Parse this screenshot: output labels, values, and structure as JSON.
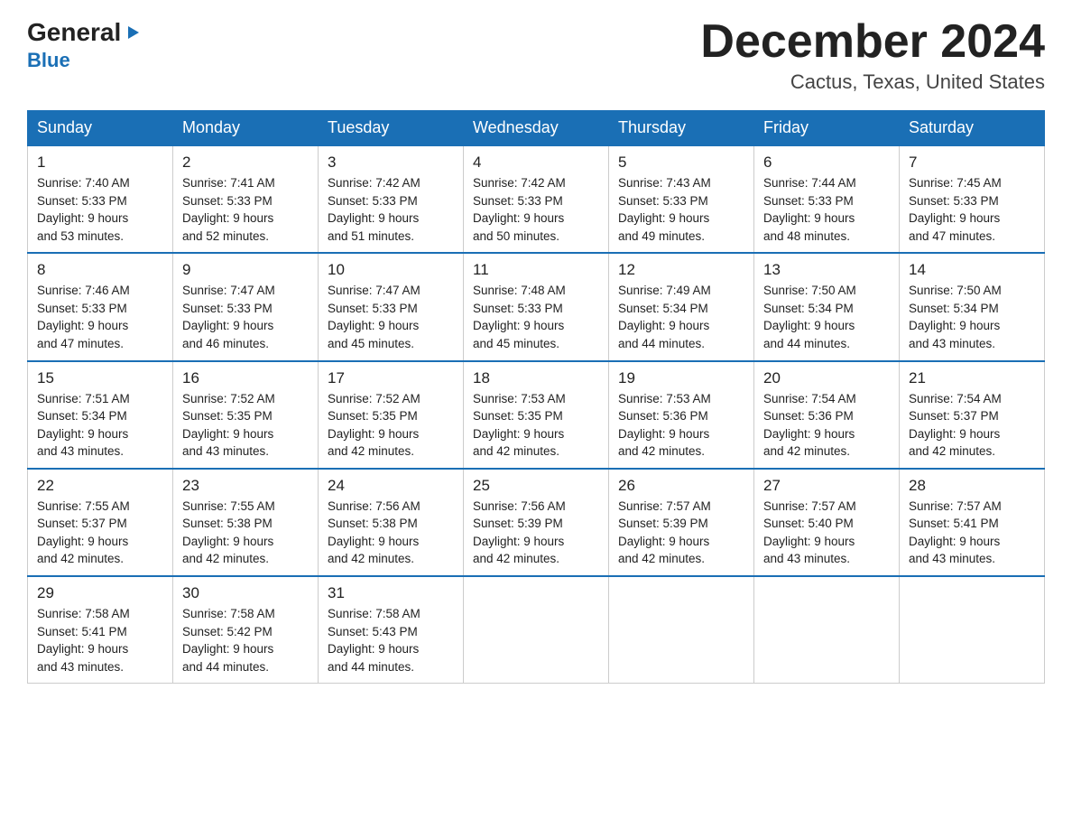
{
  "header": {
    "logo": {
      "general": "General",
      "blue": "Blue"
    },
    "title": "December 2024",
    "location": "Cactus, Texas, United States"
  },
  "weekdays": [
    "Sunday",
    "Monday",
    "Tuesday",
    "Wednesday",
    "Thursday",
    "Friday",
    "Saturday"
  ],
  "weeks": [
    [
      {
        "day": "1",
        "sunrise": "7:40 AM",
        "sunset": "5:33 PM",
        "daylight": "9 hours and 53 minutes."
      },
      {
        "day": "2",
        "sunrise": "7:41 AM",
        "sunset": "5:33 PM",
        "daylight": "9 hours and 52 minutes."
      },
      {
        "day": "3",
        "sunrise": "7:42 AM",
        "sunset": "5:33 PM",
        "daylight": "9 hours and 51 minutes."
      },
      {
        "day": "4",
        "sunrise": "7:42 AM",
        "sunset": "5:33 PM",
        "daylight": "9 hours and 50 minutes."
      },
      {
        "day": "5",
        "sunrise": "7:43 AM",
        "sunset": "5:33 PM",
        "daylight": "9 hours and 49 minutes."
      },
      {
        "day": "6",
        "sunrise": "7:44 AM",
        "sunset": "5:33 PM",
        "daylight": "9 hours and 48 minutes."
      },
      {
        "day": "7",
        "sunrise": "7:45 AM",
        "sunset": "5:33 PM",
        "daylight": "9 hours and 47 minutes."
      }
    ],
    [
      {
        "day": "8",
        "sunrise": "7:46 AM",
        "sunset": "5:33 PM",
        "daylight": "9 hours and 47 minutes."
      },
      {
        "day": "9",
        "sunrise": "7:47 AM",
        "sunset": "5:33 PM",
        "daylight": "9 hours and 46 minutes."
      },
      {
        "day": "10",
        "sunrise": "7:47 AM",
        "sunset": "5:33 PM",
        "daylight": "9 hours and 45 minutes."
      },
      {
        "day": "11",
        "sunrise": "7:48 AM",
        "sunset": "5:33 PM",
        "daylight": "9 hours and 45 minutes."
      },
      {
        "day": "12",
        "sunrise": "7:49 AM",
        "sunset": "5:34 PM",
        "daylight": "9 hours and 44 minutes."
      },
      {
        "day": "13",
        "sunrise": "7:50 AM",
        "sunset": "5:34 PM",
        "daylight": "9 hours and 44 minutes."
      },
      {
        "day": "14",
        "sunrise": "7:50 AM",
        "sunset": "5:34 PM",
        "daylight": "9 hours and 43 minutes."
      }
    ],
    [
      {
        "day": "15",
        "sunrise": "7:51 AM",
        "sunset": "5:34 PM",
        "daylight": "9 hours and 43 minutes."
      },
      {
        "day": "16",
        "sunrise": "7:52 AM",
        "sunset": "5:35 PM",
        "daylight": "9 hours and 43 minutes."
      },
      {
        "day": "17",
        "sunrise": "7:52 AM",
        "sunset": "5:35 PM",
        "daylight": "9 hours and 42 minutes."
      },
      {
        "day": "18",
        "sunrise": "7:53 AM",
        "sunset": "5:35 PM",
        "daylight": "9 hours and 42 minutes."
      },
      {
        "day": "19",
        "sunrise": "7:53 AM",
        "sunset": "5:36 PM",
        "daylight": "9 hours and 42 minutes."
      },
      {
        "day": "20",
        "sunrise": "7:54 AM",
        "sunset": "5:36 PM",
        "daylight": "9 hours and 42 minutes."
      },
      {
        "day": "21",
        "sunrise": "7:54 AM",
        "sunset": "5:37 PM",
        "daylight": "9 hours and 42 minutes."
      }
    ],
    [
      {
        "day": "22",
        "sunrise": "7:55 AM",
        "sunset": "5:37 PM",
        "daylight": "9 hours and 42 minutes."
      },
      {
        "day": "23",
        "sunrise": "7:55 AM",
        "sunset": "5:38 PM",
        "daylight": "9 hours and 42 minutes."
      },
      {
        "day": "24",
        "sunrise": "7:56 AM",
        "sunset": "5:38 PM",
        "daylight": "9 hours and 42 minutes."
      },
      {
        "day": "25",
        "sunrise": "7:56 AM",
        "sunset": "5:39 PM",
        "daylight": "9 hours and 42 minutes."
      },
      {
        "day": "26",
        "sunrise": "7:57 AM",
        "sunset": "5:39 PM",
        "daylight": "9 hours and 42 minutes."
      },
      {
        "day": "27",
        "sunrise": "7:57 AM",
        "sunset": "5:40 PM",
        "daylight": "9 hours and 43 minutes."
      },
      {
        "day": "28",
        "sunrise": "7:57 AM",
        "sunset": "5:41 PM",
        "daylight": "9 hours and 43 minutes."
      }
    ],
    [
      {
        "day": "29",
        "sunrise": "7:58 AM",
        "sunset": "5:41 PM",
        "daylight": "9 hours and 43 minutes."
      },
      {
        "day": "30",
        "sunrise": "7:58 AM",
        "sunset": "5:42 PM",
        "daylight": "9 hours and 44 minutes."
      },
      {
        "day": "31",
        "sunrise": "7:58 AM",
        "sunset": "5:43 PM",
        "daylight": "9 hours and 44 minutes."
      },
      null,
      null,
      null,
      null
    ]
  ],
  "labels": {
    "sunrise": "Sunrise: ",
    "sunset": "Sunset: ",
    "daylight": "Daylight: "
  }
}
